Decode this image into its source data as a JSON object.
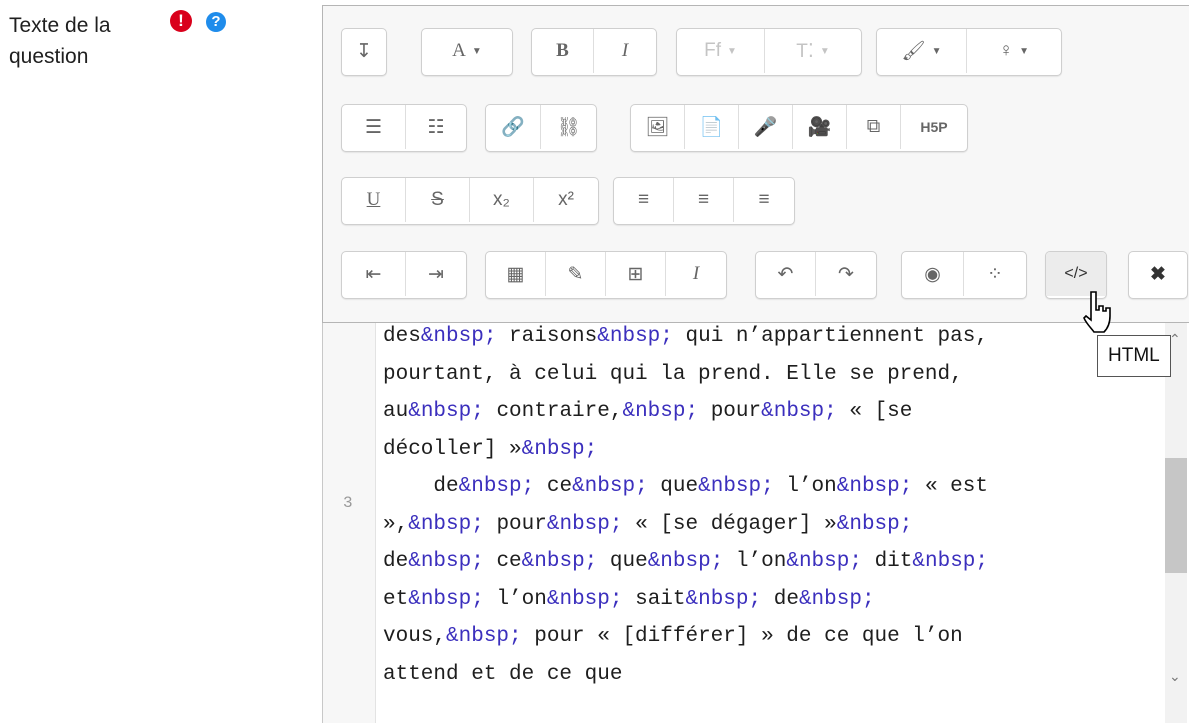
{
  "label": {
    "line1": "Texte de la",
    "line2": "question"
  },
  "icons": {
    "required": "!",
    "help": "?"
  },
  "toolbar": {
    "rows": [
      [
        [
          {
            "name": "collapse",
            "glyph": "↧"
          }
        ],
        [
          {
            "name": "font-color",
            "glyph": "A",
            "caret": true
          }
        ],
        [
          {
            "name": "bold",
            "glyph": "B"
          },
          {
            "name": "italic",
            "glyph": "I"
          }
        ],
        [
          {
            "name": "font-family",
            "glyph": "Ff",
            "caret": true,
            "disabled": true
          },
          {
            "name": "font-size",
            "glyph": "T⁚",
            "caret": true,
            "disabled": true
          }
        ],
        [
          {
            "name": "brush",
            "glyph": "🖌",
            "caret": true
          },
          {
            "name": "bulb",
            "glyph": "♀",
            "caret": true
          }
        ]
      ],
      [
        [
          {
            "name": "unordered-list",
            "glyph": "☰"
          },
          {
            "name": "ordered-list",
            "glyph": "☷"
          }
        ],
        [
          {
            "name": "link",
            "glyph": "🔗"
          },
          {
            "name": "unlink",
            "glyph": "⛓"
          }
        ],
        [
          {
            "name": "image",
            "glyph": "🖼"
          },
          {
            "name": "media",
            "glyph": "📄"
          },
          {
            "name": "record-audio",
            "glyph": "🎤"
          },
          {
            "name": "record-video",
            "glyph": "🎥"
          },
          {
            "name": "manage-files",
            "glyph": "⧉"
          },
          {
            "name": "h5p",
            "glyph": "H5P"
          }
        ]
      ],
      [
        [
          {
            "name": "underline",
            "glyph": "U"
          },
          {
            "name": "strikethrough",
            "glyph": "S"
          },
          {
            "name": "subscript",
            "glyph": "x₂"
          },
          {
            "name": "superscript",
            "glyph": "x²"
          }
        ],
        [
          {
            "name": "align-left",
            "glyph": "≡"
          },
          {
            "name": "align-center",
            "glyph": "≡"
          },
          {
            "name": "align-right",
            "glyph": "≡"
          }
        ]
      ],
      [
        [
          {
            "name": "outdent",
            "glyph": "⇤"
          },
          {
            "name": "indent",
            "glyph": "⇥"
          }
        ],
        [
          {
            "name": "equation",
            "glyph": "▦"
          },
          {
            "name": "special-chars",
            "glyph": "✎"
          },
          {
            "name": "table",
            "glyph": "⊞"
          },
          {
            "name": "clear-format",
            "glyph": "I"
          }
        ],
        [
          {
            "name": "undo",
            "glyph": "↶"
          },
          {
            "name": "redo",
            "glyph": "↷"
          }
        ],
        [
          {
            "name": "accessibility-checker",
            "glyph": "◉"
          },
          {
            "name": "screenreader-helper",
            "glyph": "⁘"
          }
        ],
        [
          {
            "name": "html",
            "glyph": "</>",
            "active": true
          }
        ],
        [
          {
            "name": "fullscreen",
            "glyph": "✖"
          }
        ]
      ]
    ]
  },
  "code": {
    "gutter_line": "3",
    "lines": [
      "des&nbsp; raisons&nbsp; qui n’appartiennent pas,",
      "pourtant, à celui qui la prend. Elle se prend,",
      "au&nbsp; contraire,&nbsp; pour&nbsp; « [se",
      "décoller] »&nbsp;",
      "    de&nbsp; ce&nbsp; que&nbsp; l’on&nbsp; « est",
      "»,&nbsp; pour&nbsp; « [se dégager] »&nbsp;",
      "de&nbsp; ce&nbsp; que&nbsp; l’on&nbsp; dit&nbsp;",
      "et&nbsp; l’on&nbsp; sait&nbsp; de&nbsp;",
      "vous,&nbsp; pour « [différer] » de ce que l’on",
      "attend et de ce que"
    ]
  },
  "tooltip": "HTML"
}
